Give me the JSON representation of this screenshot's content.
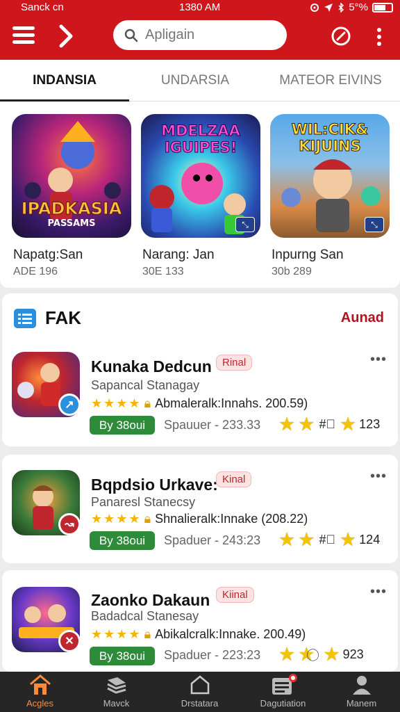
{
  "status": {
    "carrier": "Sanck cn",
    "time": "1380 AM",
    "battery": "5°%"
  },
  "header": {
    "search_placeholder": "Apligain"
  },
  "tabs": [
    {
      "label": "INDANSIA",
      "active": true
    },
    {
      "label": "UNDARSIA",
      "active": false
    },
    {
      "label": "MATEOR EIVINS",
      "active": false
    }
  ],
  "featured": [
    {
      "art_title": "IPADKASIA",
      "art_sub": "PASSAMS",
      "name": "Napatg:San",
      "meta": "ADE 196"
    },
    {
      "art_title": "MDELZAA IGUIPES!",
      "art_sub": "",
      "name": "Narang: Jan",
      "meta": "30E 133"
    },
    {
      "art_title": "WIL:CIK& KIJUINS",
      "art_sub": "",
      "name": "Inpurng San",
      "meta": "30b 289"
    }
  ],
  "fak": {
    "title": "FAK",
    "link": "Aunad"
  },
  "apps": [
    {
      "name": "Kunaka Dedcun",
      "pill": "Rinal",
      "sub": "Sapancal Stanagay",
      "rating_text": "Abmaleralk:Innahs. 200.59)",
      "buy": "By 38oui",
      "price": "Spauuer - 233.33",
      "mid": "#⃝",
      "count": "123",
      "badge": "check"
    },
    {
      "name": "Bqpdsio Urkave:",
      "pill": "Kinal",
      "sub": "Panaresl Stanecsy",
      "rating_text": "Shnalieralk:Innake (208.22)",
      "buy": "By 38oui",
      "price": "Spaduer - 243:23",
      "mid": "#⃝",
      "count": "124",
      "badge": "up"
    },
    {
      "name": "Zaonko Dakaun",
      "pill": "Kiinal",
      "sub": "Badadcal Stanesay",
      "rating_text": "Abikalcralk:Innake. 200.49)",
      "buy": "By 38oui",
      "price": "Spaduer - 223:23",
      "mid": "⃝",
      "count": "923",
      "badge": "x"
    }
  ],
  "nav": [
    {
      "label": "Acgles",
      "icon": "home-icon",
      "active": true
    },
    {
      "label": "Mavck",
      "icon": "stack-icon",
      "active": false
    },
    {
      "label": "Drstatara",
      "icon": "house-outline-icon",
      "active": false
    },
    {
      "label": "Dagutiation",
      "icon": "calendar-icon",
      "active": false
    },
    {
      "label": "Manem",
      "icon": "person-icon",
      "active": false
    }
  ],
  "colors": {
    "brand": "#d0161d",
    "accent": "#b0141b",
    "buy": "#2e8b3a",
    "nav_active": "#ff8a3c"
  }
}
